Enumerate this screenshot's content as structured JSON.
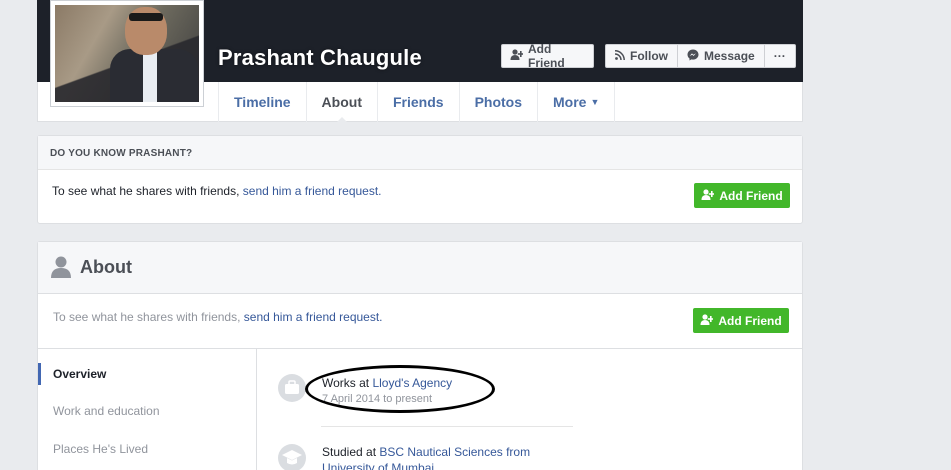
{
  "profile": {
    "name": "Prashant Chaugule",
    "picture_icon": "profile-photo"
  },
  "header_buttons": {
    "add_friend": "Add Friend",
    "follow": "Follow",
    "message": "Message",
    "more": "···"
  },
  "nav": {
    "tabs": [
      {
        "label": "Timeline",
        "active": false
      },
      {
        "label": "About",
        "active": true
      },
      {
        "label": "Friends",
        "active": false
      },
      {
        "label": "Photos",
        "active": false
      },
      {
        "label": "More",
        "active": false
      }
    ]
  },
  "know_card": {
    "heading": "DO YOU KNOW PRASHANT?",
    "text": "To see what he shares with friends, ",
    "link": "send him a friend request.",
    "button": "Add Friend"
  },
  "about": {
    "title": "About",
    "sub_text": "To see what he shares with friends, ",
    "sub_link": "send him a friend request.",
    "button": "Add Friend",
    "sidebar": [
      {
        "label": "Overview",
        "active": true
      },
      {
        "label": "Work and education",
        "active": false
      },
      {
        "label": "Places He's Lived",
        "active": false
      }
    ],
    "entries": [
      {
        "prefix": "Works at ",
        "link": "Lloyd's Agency",
        "sub": "7 April 2014 to present",
        "icon": "briefcase-icon"
      },
      {
        "prefix": "Studied at ",
        "link": "BSC Nautical Sciences from",
        "link2": "University of Mumbai",
        "icon": "graduation-cap-icon"
      }
    ]
  },
  "colors": {
    "cover": "#1d2129",
    "link": "#365899",
    "green": "#42b72a",
    "background": "#e9ebee"
  }
}
